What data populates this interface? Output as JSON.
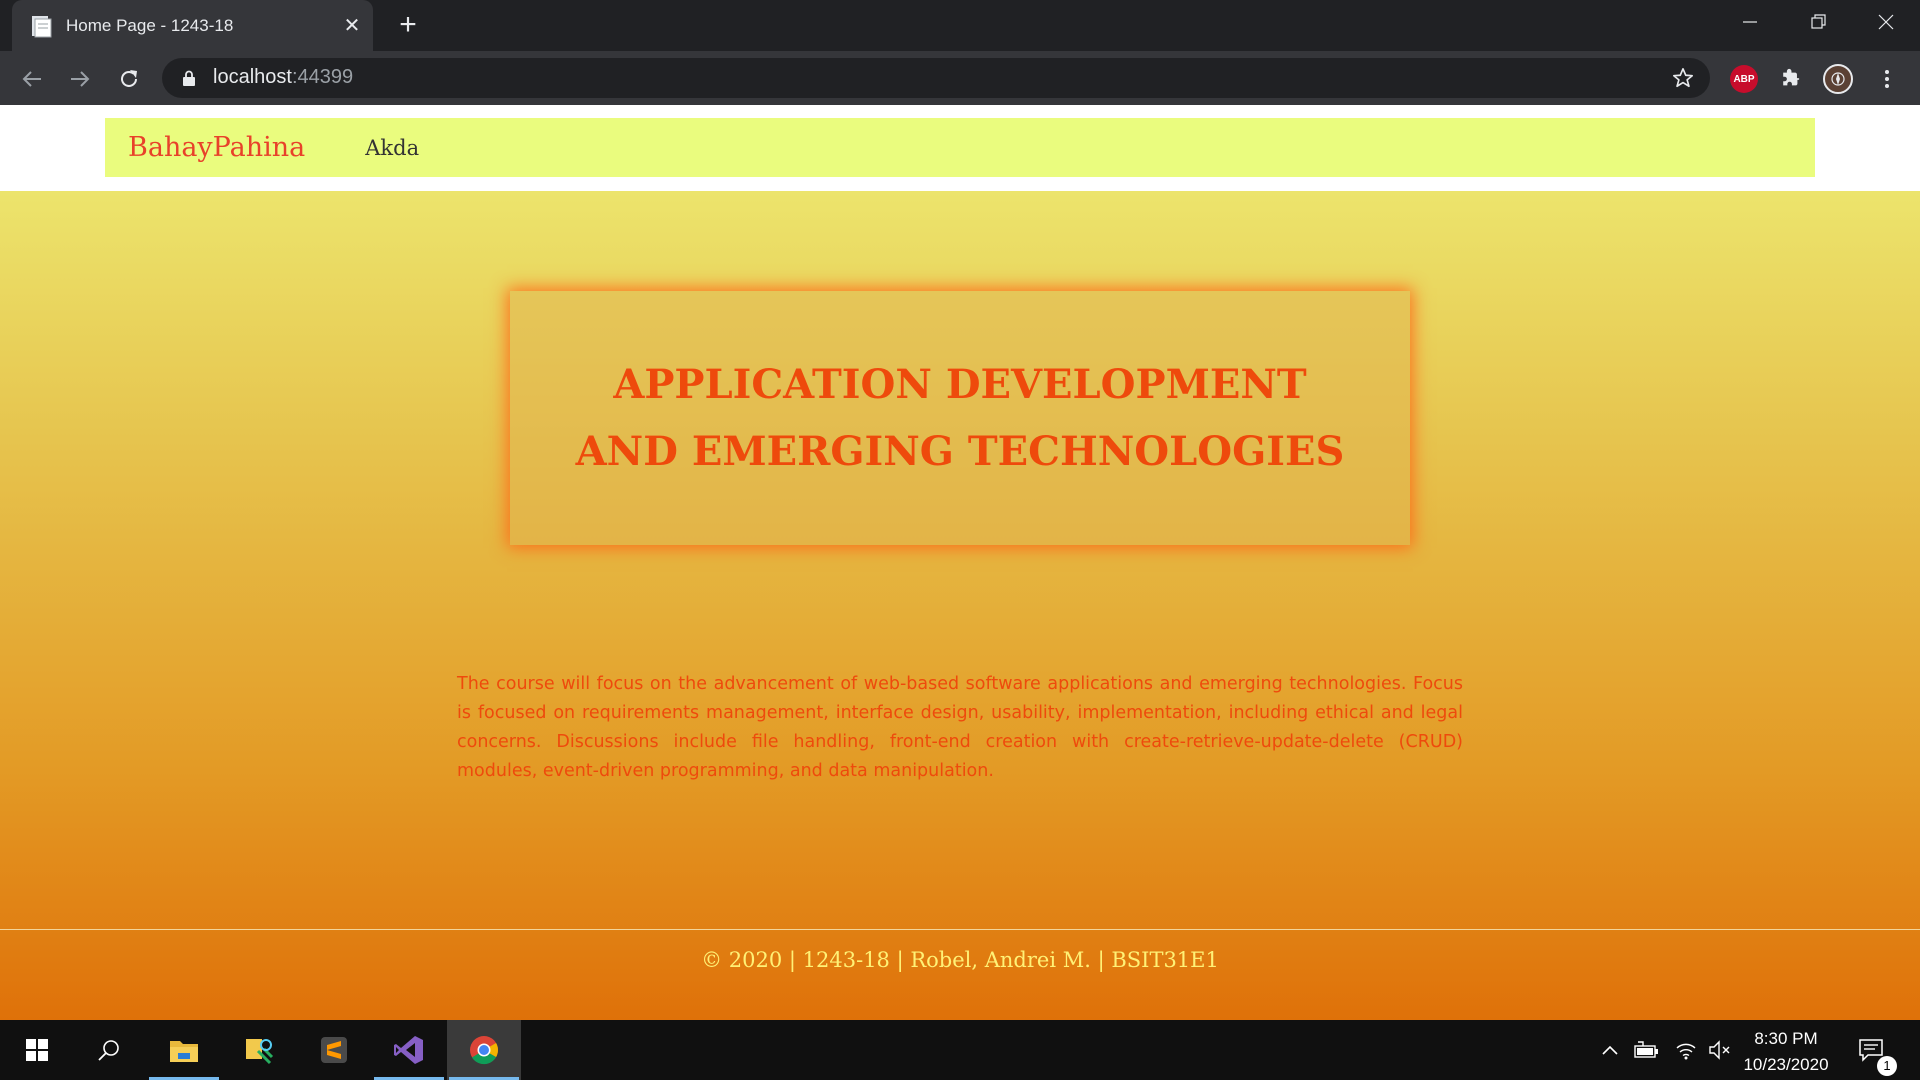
{
  "browser": {
    "tab_title": "Home Page - 1243-18",
    "url_host": "localhost",
    "url_port": ":44399"
  },
  "navbar": {
    "brand": "BahayPahina",
    "links": [
      "Akda"
    ]
  },
  "hero": {
    "title": "APPLICATION DEVELOPMENT AND EMERGING TECHNOLOGIES",
    "description": "The course will focus on the advancement of web-based software applications and emerging technologies. Focus is focused on requirements management, interface design, usability, implementation, including ethical and legal concerns. Discussions include file handling, front-end creation with create-retrieve-update-delete (CRUD) modules, event-driven programming, and data manipulation."
  },
  "footer": {
    "text": "© 2020 | 1243-18 | Robel, Andrei M. | BSIT31E1"
  },
  "taskbar": {
    "time": "8:30 PM",
    "date": "10/23/2020",
    "notification_count": "1"
  },
  "colors": {
    "accent_text": "#ee4a0c",
    "brand": "#e8412a",
    "navbar_bg": "#eafc7e",
    "footer_text": "#fff176"
  },
  "icons": [
    "tab-page-icon",
    "tab-close-icon",
    "new-tab-icon",
    "minimize-icon",
    "restore-icon",
    "window-close-icon",
    "back-icon",
    "forward-icon",
    "reload-icon",
    "lock-icon",
    "bookmark-star-icon",
    "adblock-icon",
    "extensions-icon",
    "profile-avatar-icon",
    "browser-menu-icon",
    "windows-start-icon",
    "search-icon",
    "file-explorer-icon",
    "tool-icon",
    "sublime-text-icon",
    "visual-studio-icon",
    "chrome-icon",
    "tray-chevron-icon",
    "battery-icon",
    "wifi-icon",
    "volume-muted-icon",
    "notifications-icon"
  ]
}
